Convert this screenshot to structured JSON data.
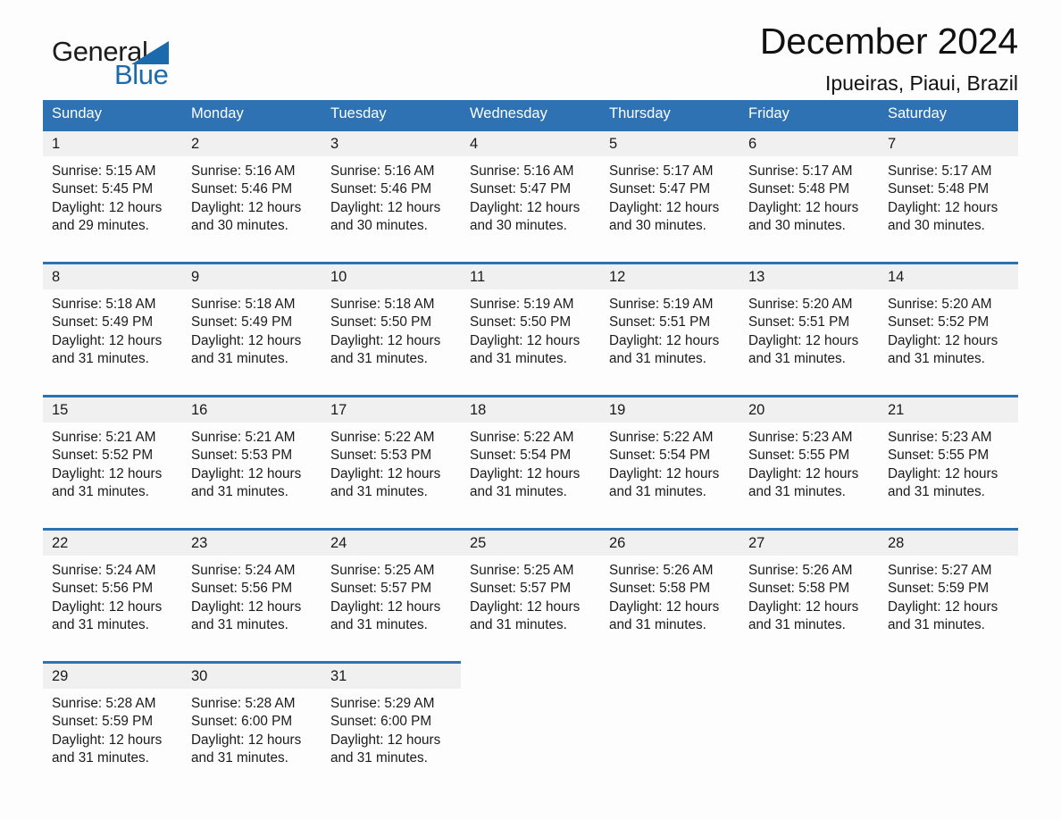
{
  "brand": {
    "logo_text_1": "General",
    "logo_text_2": "Blue",
    "logo_triangle_icon": "triangle-icon",
    "accent_color": "#2e72b4",
    "header_text_color": "#ffffff",
    "daynum_band_color": "#f0f0f0",
    "page_background": "#fdfdfd"
  },
  "header": {
    "title": "December 2024",
    "subtitle": "Ipueiras, Piaui, Brazil"
  },
  "calendar": {
    "day_names": [
      "Sunday",
      "Monday",
      "Tuesday",
      "Wednesday",
      "Thursday",
      "Friday",
      "Saturday"
    ],
    "labels": {
      "sunrise": "Sunrise:",
      "sunset": "Sunset:",
      "daylight": "Daylight:"
    },
    "weeks": [
      [
        {
          "day": "1",
          "sunrise": "Sunrise: 5:15 AM",
          "sunset": "Sunset: 5:45 PM",
          "daylight": "Daylight: 12 hours and 29 minutes."
        },
        {
          "day": "2",
          "sunrise": "Sunrise: 5:16 AM",
          "sunset": "Sunset: 5:46 PM",
          "daylight": "Daylight: 12 hours and 30 minutes."
        },
        {
          "day": "3",
          "sunrise": "Sunrise: 5:16 AM",
          "sunset": "Sunset: 5:46 PM",
          "daylight": "Daylight: 12 hours and 30 minutes."
        },
        {
          "day": "4",
          "sunrise": "Sunrise: 5:16 AM",
          "sunset": "Sunset: 5:47 PM",
          "daylight": "Daylight: 12 hours and 30 minutes."
        },
        {
          "day": "5",
          "sunrise": "Sunrise: 5:17 AM",
          "sunset": "Sunset: 5:47 PM",
          "daylight": "Daylight: 12 hours and 30 minutes."
        },
        {
          "day": "6",
          "sunrise": "Sunrise: 5:17 AM",
          "sunset": "Sunset: 5:48 PM",
          "daylight": "Daylight: 12 hours and 30 minutes."
        },
        {
          "day": "7",
          "sunrise": "Sunrise: 5:17 AM",
          "sunset": "Sunset: 5:48 PM",
          "daylight": "Daylight: 12 hours and 30 minutes."
        }
      ],
      [
        {
          "day": "8",
          "sunrise": "Sunrise: 5:18 AM",
          "sunset": "Sunset: 5:49 PM",
          "daylight": "Daylight: 12 hours and 31 minutes."
        },
        {
          "day": "9",
          "sunrise": "Sunrise: 5:18 AM",
          "sunset": "Sunset: 5:49 PM",
          "daylight": "Daylight: 12 hours and 31 minutes."
        },
        {
          "day": "10",
          "sunrise": "Sunrise: 5:18 AM",
          "sunset": "Sunset: 5:50 PM",
          "daylight": "Daylight: 12 hours and 31 minutes."
        },
        {
          "day": "11",
          "sunrise": "Sunrise: 5:19 AM",
          "sunset": "Sunset: 5:50 PM",
          "daylight": "Daylight: 12 hours and 31 minutes."
        },
        {
          "day": "12",
          "sunrise": "Sunrise: 5:19 AM",
          "sunset": "Sunset: 5:51 PM",
          "daylight": "Daylight: 12 hours and 31 minutes."
        },
        {
          "day": "13",
          "sunrise": "Sunrise: 5:20 AM",
          "sunset": "Sunset: 5:51 PM",
          "daylight": "Daylight: 12 hours and 31 minutes."
        },
        {
          "day": "14",
          "sunrise": "Sunrise: 5:20 AM",
          "sunset": "Sunset: 5:52 PM",
          "daylight": "Daylight: 12 hours and 31 minutes."
        }
      ],
      [
        {
          "day": "15",
          "sunrise": "Sunrise: 5:21 AM",
          "sunset": "Sunset: 5:52 PM",
          "daylight": "Daylight: 12 hours and 31 minutes."
        },
        {
          "day": "16",
          "sunrise": "Sunrise: 5:21 AM",
          "sunset": "Sunset: 5:53 PM",
          "daylight": "Daylight: 12 hours and 31 minutes."
        },
        {
          "day": "17",
          "sunrise": "Sunrise: 5:22 AM",
          "sunset": "Sunset: 5:53 PM",
          "daylight": "Daylight: 12 hours and 31 minutes."
        },
        {
          "day": "18",
          "sunrise": "Sunrise: 5:22 AM",
          "sunset": "Sunset: 5:54 PM",
          "daylight": "Daylight: 12 hours and 31 minutes."
        },
        {
          "day": "19",
          "sunrise": "Sunrise: 5:22 AM",
          "sunset": "Sunset: 5:54 PM",
          "daylight": "Daylight: 12 hours and 31 minutes."
        },
        {
          "day": "20",
          "sunrise": "Sunrise: 5:23 AM",
          "sunset": "Sunset: 5:55 PM",
          "daylight": "Daylight: 12 hours and 31 minutes."
        },
        {
          "day": "21",
          "sunrise": "Sunrise: 5:23 AM",
          "sunset": "Sunset: 5:55 PM",
          "daylight": "Daylight: 12 hours and 31 minutes."
        }
      ],
      [
        {
          "day": "22",
          "sunrise": "Sunrise: 5:24 AM",
          "sunset": "Sunset: 5:56 PM",
          "daylight": "Daylight: 12 hours and 31 minutes."
        },
        {
          "day": "23",
          "sunrise": "Sunrise: 5:24 AM",
          "sunset": "Sunset: 5:56 PM",
          "daylight": "Daylight: 12 hours and 31 minutes."
        },
        {
          "day": "24",
          "sunrise": "Sunrise: 5:25 AM",
          "sunset": "Sunset: 5:57 PM",
          "daylight": "Daylight: 12 hours and 31 minutes."
        },
        {
          "day": "25",
          "sunrise": "Sunrise: 5:25 AM",
          "sunset": "Sunset: 5:57 PM",
          "daylight": "Daylight: 12 hours and 31 minutes."
        },
        {
          "day": "26",
          "sunrise": "Sunrise: 5:26 AM",
          "sunset": "Sunset: 5:58 PM",
          "daylight": "Daylight: 12 hours and 31 minutes."
        },
        {
          "day": "27",
          "sunrise": "Sunrise: 5:26 AM",
          "sunset": "Sunset: 5:58 PM",
          "daylight": "Daylight: 12 hours and 31 minutes."
        },
        {
          "day": "28",
          "sunrise": "Sunrise: 5:27 AM",
          "sunset": "Sunset: 5:59 PM",
          "daylight": "Daylight: 12 hours and 31 minutes."
        }
      ],
      [
        {
          "day": "29",
          "sunrise": "Sunrise: 5:28 AM",
          "sunset": "Sunset: 5:59 PM",
          "daylight": "Daylight: 12 hours and 31 minutes."
        },
        {
          "day": "30",
          "sunrise": "Sunrise: 5:28 AM",
          "sunset": "Sunset: 6:00 PM",
          "daylight": "Daylight: 12 hours and 31 minutes."
        },
        {
          "day": "31",
          "sunrise": "Sunrise: 5:29 AM",
          "sunset": "Sunset: 6:00 PM",
          "daylight": "Daylight: 12 hours and 31 minutes."
        },
        null,
        null,
        null,
        null
      ]
    ]
  }
}
